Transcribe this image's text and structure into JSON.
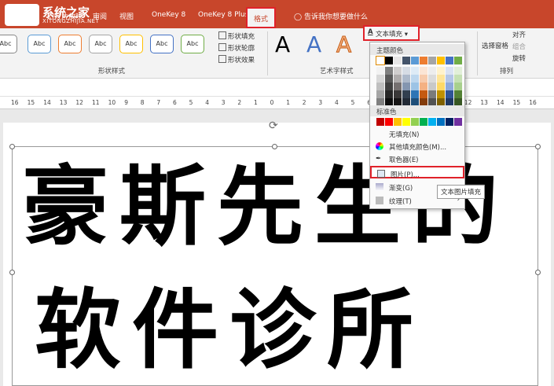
{
  "titlebar": {
    "logo_text": "系统之家",
    "logo_sub": "XITONGZHIJIA.NET",
    "tabs": [
      {
        "label": "幻灯片放映"
      },
      {
        "label": "审阅"
      },
      {
        "label": "视图"
      },
      {
        "label": "OneKey 8"
      },
      {
        "label": "OneKey 8 Plus"
      },
      {
        "label": "格式"
      }
    ],
    "tell_me": "告诉我你想要做什么"
  },
  "ribbon": {
    "shape_styles": {
      "swatch_label": "Abc",
      "group_label": "形状样式",
      "fill": "形状填充",
      "outline": "形状轮廓",
      "effect": "形状效果"
    },
    "wordart": {
      "glyph": "A",
      "group_label": "艺术字样式",
      "text_fill": "文本填充"
    },
    "arrange": {
      "align": "对齐",
      "group": "组合",
      "rotate": "旋转",
      "selection_pane": "选择窗格",
      "group_label": "排列"
    }
  },
  "ruler": {
    "ticks": [
      "16",
      "15",
      "14",
      "13",
      "12",
      "11",
      "10",
      "9",
      "8",
      "7",
      "6",
      "5",
      "4",
      "3",
      "2",
      "1",
      "0",
      "1",
      "2",
      "3",
      "4",
      "5",
      "6",
      "7",
      "8",
      "9",
      "10",
      "11",
      "12",
      "13",
      "14",
      "15",
      "16"
    ]
  },
  "slide": {
    "line1": "豪斯先生的",
    "line2": "软件诊所"
  },
  "dropdown": {
    "theme_colors_label": "主题颜色",
    "standard_colors_label": "标准色",
    "items": [
      {
        "label": "无填充(N)"
      },
      {
        "label": "其他填充颜色(M)..."
      },
      {
        "label": "取色器(E)"
      },
      {
        "label": "图片(P)..."
      },
      {
        "label": "渐变(G)"
      },
      {
        "label": "纹理(T)"
      }
    ],
    "tooltip": "文本图片填充",
    "theme_colors": [
      [
        "#ffffff",
        "#000000",
        "#e7e6e6",
        "#44546a",
        "#5b9bd5",
        "#ed7d31",
        "#a5a5a5",
        "#ffc000",
        "#4472c4",
        "#70ad47"
      ],
      [
        "#f2f2f2",
        "#7f7f7f",
        "#d0cece",
        "#d6dce4",
        "#deebf6",
        "#fbe5d5",
        "#ededed",
        "#fff2cc",
        "#d9e2f3",
        "#e2efd9"
      ],
      [
        "#d8d8d8",
        "#595959",
        "#aeabab",
        "#adb9ca",
        "#bdd7ee",
        "#f7cbac",
        "#dbdbdb",
        "#fee599",
        "#b4c6e7",
        "#c5e0b3"
      ],
      [
        "#bfbfbf",
        "#3f3f3f",
        "#757070",
        "#8496b0",
        "#9cc3e5",
        "#f4b183",
        "#c9c9c9",
        "#ffd965",
        "#8eaadb",
        "#a8d08d"
      ],
      [
        "#a5a5a5",
        "#262626",
        "#3a3838",
        "#323f4f",
        "#2e75b5",
        "#c55a11",
        "#7b7b7b",
        "#bf9000",
        "#2f5496",
        "#538135"
      ],
      [
        "#7f7f7f",
        "#0c0c0c",
        "#171616",
        "#222a35",
        "#1e4e79",
        "#833c0b",
        "#525252",
        "#7f6000",
        "#1f3864",
        "#375623"
      ]
    ],
    "standard_colors": [
      "#c00000",
      "#ff0000",
      "#ffc000",
      "#ffff00",
      "#92d050",
      "#00b050",
      "#00b0f0",
      "#0070c0",
      "#002060",
      "#7030a0"
    ]
  }
}
